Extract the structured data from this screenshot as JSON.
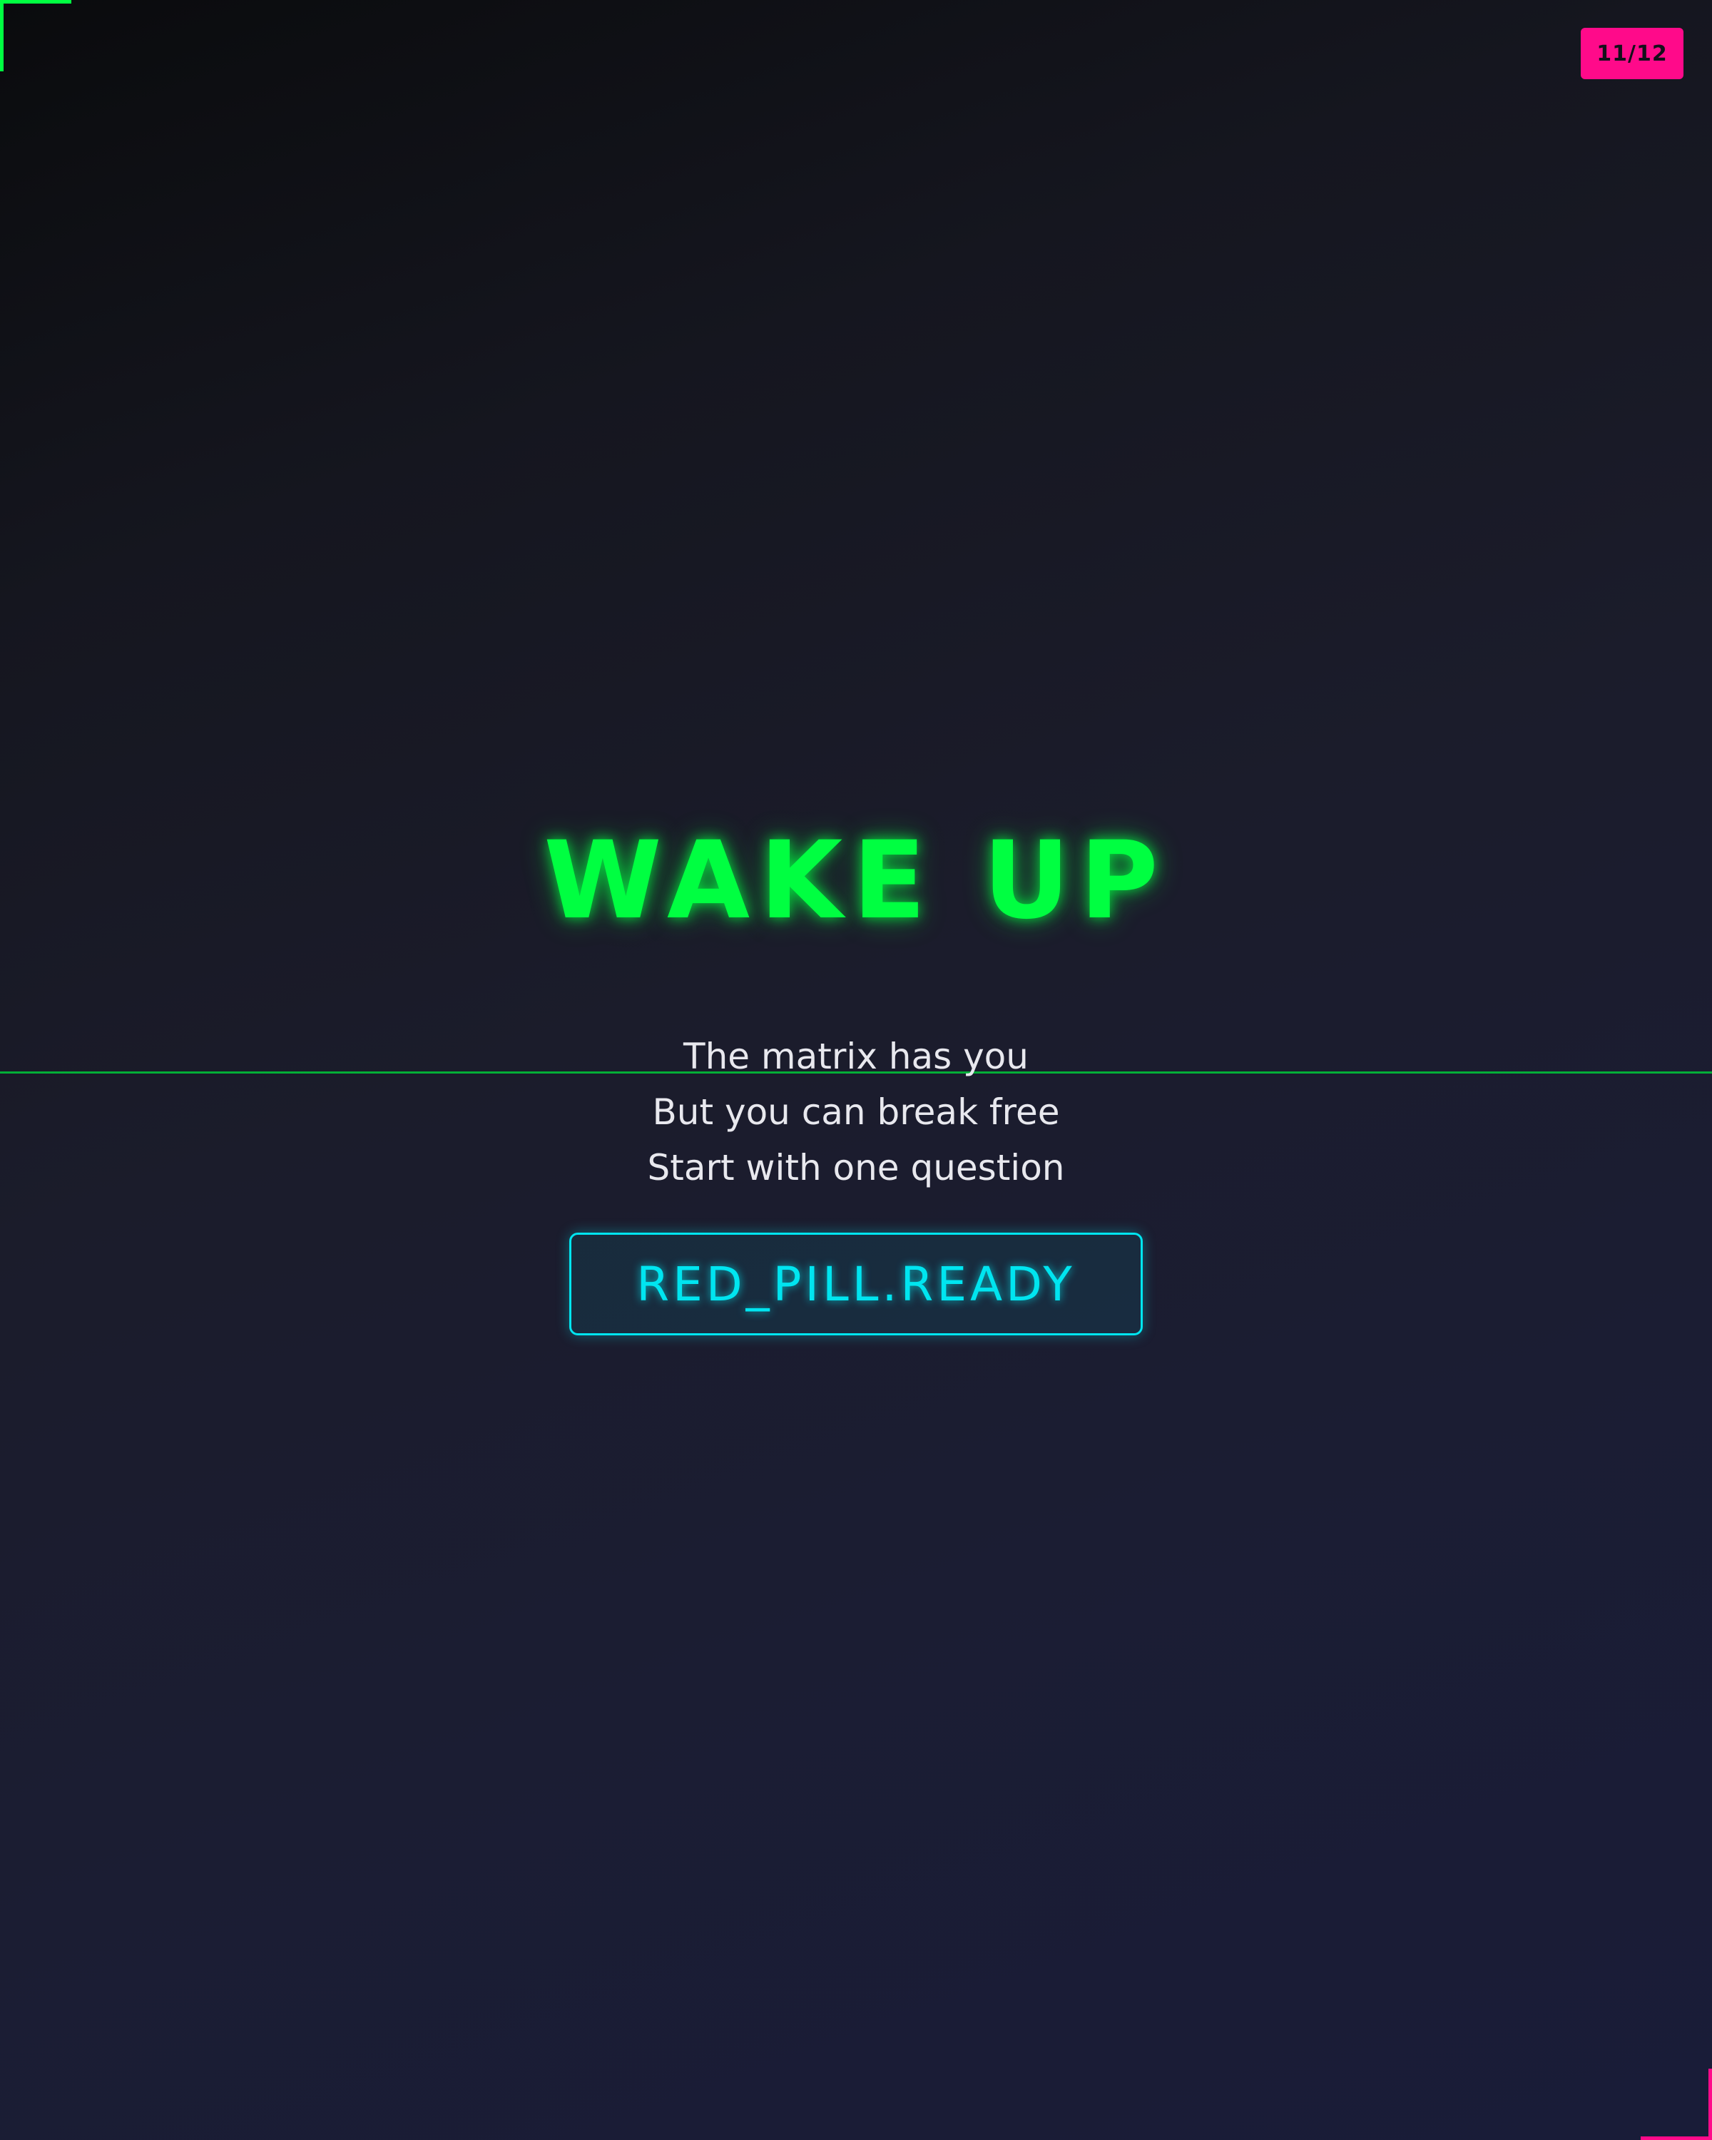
{
  "slide": {
    "counter": "11/12",
    "title": "WAKE UP",
    "subtitle_lines": [
      "The matrix has you",
      "But you can break free",
      "Start with one question"
    ],
    "button_label": "RED_PILL.READY"
  },
  "colors": {
    "neon_green": "#00ff41",
    "neon_pink": "#ff0a8a",
    "neon_cyan": "#00e5f0",
    "text_white": "#e8e8ee",
    "background_dark": "#1b1c2b"
  }
}
